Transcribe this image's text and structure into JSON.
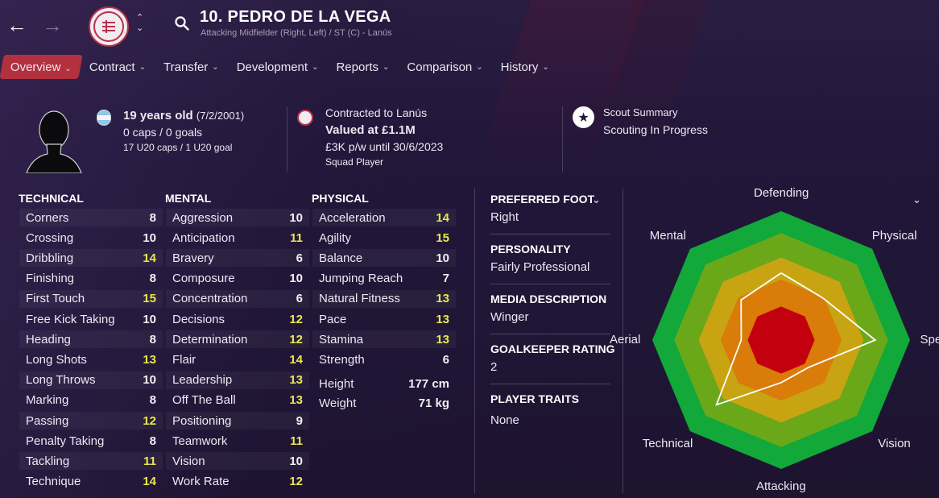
{
  "header": {
    "back_icon": "arrow-left-icon",
    "forward_icon": "arrow-right-icon",
    "player_name": "10. PEDRO DE LA VEGA",
    "player_subtitle": "Attacking Midfielder (Right, Left) / ST (C) - Lanús"
  },
  "tabs": [
    {
      "label": "Overview",
      "active": true
    },
    {
      "label": "Contract",
      "active": false
    },
    {
      "label": "Transfer",
      "active": false
    },
    {
      "label": "Development",
      "active": false
    },
    {
      "label": "Reports",
      "active": false
    },
    {
      "label": "Comparison",
      "active": false
    },
    {
      "label": "History",
      "active": false
    }
  ],
  "bio": {
    "age": "19 years old",
    "dob": "(7/2/2001)",
    "caps": "0 caps / 0 goals",
    "u20": "17 U20 caps / 1 U20 goal"
  },
  "contract": {
    "club": "Contracted to Lanús",
    "value": "Valued at £1.1M",
    "wage": "£3K p/w until 30/6/2023",
    "status": "Squad Player"
  },
  "scout": {
    "title": "Scout Summary",
    "status": "Scouting In Progress"
  },
  "attributes": {
    "technical": {
      "title": "TECHNICAL",
      "rows": [
        {
          "name": "Corners",
          "value": "8"
        },
        {
          "name": "Crossing",
          "value": "10"
        },
        {
          "name": "Dribbling",
          "value": "14"
        },
        {
          "name": "Finishing",
          "value": "8"
        },
        {
          "name": "First Touch",
          "value": "15"
        },
        {
          "name": "Free Kick Taking",
          "value": "10"
        },
        {
          "name": "Heading",
          "value": "8"
        },
        {
          "name": "Long Shots",
          "value": "13"
        },
        {
          "name": "Long Throws",
          "value": "10"
        },
        {
          "name": "Marking",
          "value": "8"
        },
        {
          "name": "Passing",
          "value": "12"
        },
        {
          "name": "Penalty Taking",
          "value": "8"
        },
        {
          "name": "Tackling",
          "value": "11"
        },
        {
          "name": "Technique",
          "value": "14"
        }
      ]
    },
    "mental": {
      "title": "MENTAL",
      "rows": [
        {
          "name": "Aggression",
          "value": "10"
        },
        {
          "name": "Anticipation",
          "value": "11"
        },
        {
          "name": "Bravery",
          "value": "6"
        },
        {
          "name": "Composure",
          "value": "10"
        },
        {
          "name": "Concentration",
          "value": "6"
        },
        {
          "name": "Decisions",
          "value": "12"
        },
        {
          "name": "Determination",
          "value": "12"
        },
        {
          "name": "Flair",
          "value": "14"
        },
        {
          "name": "Leadership",
          "value": "13"
        },
        {
          "name": "Off The Ball",
          "value": "13"
        },
        {
          "name": "Positioning",
          "value": "9"
        },
        {
          "name": "Teamwork",
          "value": "11"
        },
        {
          "name": "Vision",
          "value": "10"
        },
        {
          "name": "Work Rate",
          "value": "12"
        }
      ]
    },
    "physical": {
      "title": "PHYSICAL",
      "rows": [
        {
          "name": "Acceleration",
          "value": "14"
        },
        {
          "name": "Agility",
          "value": "15"
        },
        {
          "name": "Balance",
          "value": "10"
        },
        {
          "name": "Jumping Reach",
          "value": "7"
        },
        {
          "name": "Natural Fitness",
          "value": "13"
        },
        {
          "name": "Pace",
          "value": "13"
        },
        {
          "name": "Stamina",
          "value": "13"
        },
        {
          "name": "Strength",
          "value": "6"
        }
      ],
      "height_label": "Height",
      "height_value": "177 cm",
      "weight_label": "Weight",
      "weight_value": "71 kg"
    }
  },
  "profile": {
    "preferred_foot_title": "PREFERRED FOOT",
    "preferred_foot": "Right",
    "personality_title": "PERSONALITY",
    "personality": "Fairly Professional",
    "media_title": "MEDIA DESCRIPTION",
    "media": "Winger",
    "gk_title": "GOALKEEPER RATING",
    "gk": "2",
    "traits_title": "PLAYER TRAITS",
    "traits": "None"
  },
  "radar": {
    "labels": [
      "Defending",
      "Physical",
      "Speed",
      "Vision",
      "Attacking",
      "Technical",
      "Aerial",
      "Mental"
    ],
    "values": [
      0.52,
      0.46,
      0.73,
      0.3,
      0.33,
      0.71,
      0.31,
      0.44
    ],
    "colors": [
      "#12a83a",
      "#6aa81a",
      "#c8a412",
      "#d97c0a",
      "#c2000e"
    ]
  }
}
